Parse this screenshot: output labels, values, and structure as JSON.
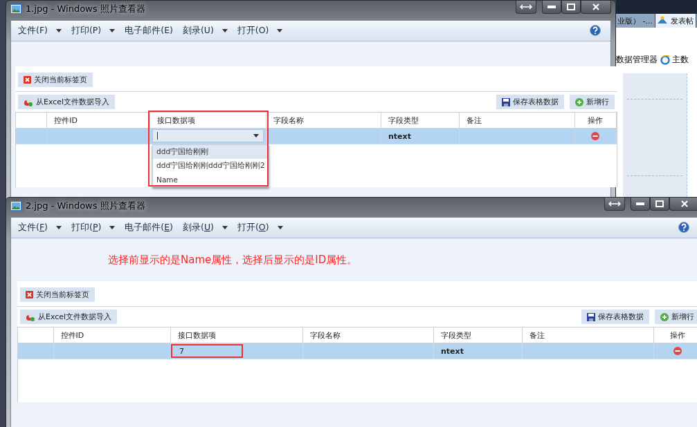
{
  "background": {
    "tabs": [
      {
        "label": "业版） -...",
        "selected": false
      },
      {
        "label": "发表帖",
        "selected": true
      }
    ],
    "toolbar_links": [
      "数据管理器",
      "主数"
    ]
  },
  "windows": [
    {
      "title": "1.jpg - Windows 照片查看器",
      "accelerators_underlined": false,
      "menu": [
        {
          "label": "文件(F)",
          "dropdown": true
        },
        {
          "label": "打印(P)",
          "dropdown": true
        },
        {
          "label": "电子邮件(E)",
          "dropdown": false
        },
        {
          "label": "刻录(U)",
          "dropdown": true
        },
        {
          "label": "打开(O)",
          "dropdown": true
        }
      ],
      "page": {
        "close_tab_button": "关闭当前标签页",
        "import_button": "从Excel文件数据导入",
        "save_button": "保存表格数据",
        "add_row_button": "新增行",
        "annotation_frame": {
          "kind": "column"
        },
        "columns": [
          "控件ID",
          "接口数据项",
          "字段名称",
          "字段类型",
          "备注",
          "操作"
        ],
        "rows": [
          {
            "selected": true,
            "interface_item": {
              "kind": "combo",
              "options": [
                {
                  "label": "ddd宁国给刚刚",
                  "selected": true
                },
                {
                  "label": "ddd宁国给刚刚ddd宁国给刚刚2",
                  "selected": false
                },
                {
                  "label": "Name",
                  "selected": false
                }
              ]
            },
            "field_type": "ntext"
          }
        ]
      }
    },
    {
      "title": "2.jpg - Windows 照片查看器",
      "accelerators_underlined": true,
      "menu": [
        {
          "label": "文件(F)",
          "dropdown": true
        },
        {
          "label": "打印(P)",
          "dropdown": true
        },
        {
          "label": "电子邮件(E)",
          "dropdown": false
        },
        {
          "label": "刻录(U)",
          "dropdown": true
        },
        {
          "label": "打开(O)",
          "dropdown": true
        }
      ],
      "note": "选择前显示的是Name属性，选择后显示的是ID属性。",
      "page": {
        "close_tab_button": "关闭当前标签页",
        "import_button": "从Excel文件数据导入",
        "save_button": "保存表格数据",
        "add_row_button": "新增行",
        "annotation_frame": {
          "kind": "cell"
        },
        "columns": [
          "控件ID",
          "接口数据项",
          "字段名称",
          "字段类型",
          "备注",
          "操作"
        ],
        "rows": [
          {
            "selected": true,
            "interface_item": {
              "kind": "value",
              "value": "7"
            },
            "field_type": "ntext"
          }
        ]
      }
    }
  ]
}
